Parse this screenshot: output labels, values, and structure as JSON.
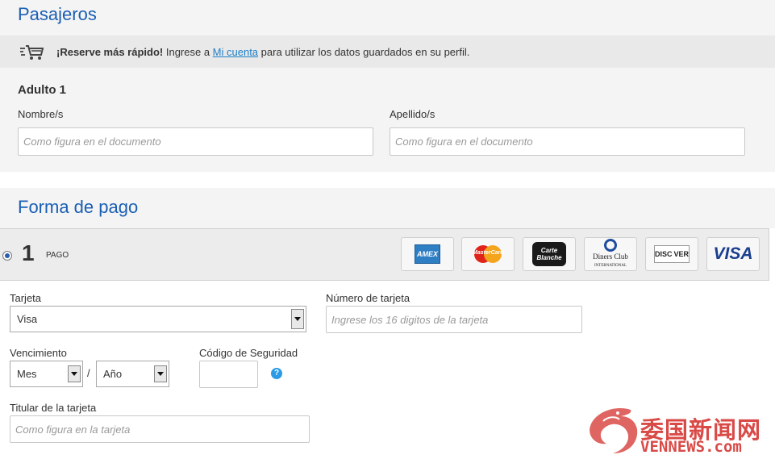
{
  "passengers": {
    "title": "Pasajeros",
    "notice": {
      "bold": "¡Reserve más rápido!",
      "before_link": " Ingrese a ",
      "link": "Mi cuenta",
      "after_link": " para utilizar los datos guardados en su perfil."
    },
    "adult_title": "Adulto 1",
    "first_name_label": "Nombre/s",
    "first_name_placeholder": "Como figura en el documento",
    "last_name_label": "Apellido/s",
    "last_name_placeholder": "Como figura en el documento"
  },
  "payment": {
    "title": "Forma de pago",
    "installments_number": "1",
    "installments_label": "PAGO",
    "cards": [
      {
        "name": "AMEX",
        "icon": "amex-icon"
      },
      {
        "name": "MasterCard",
        "icon": "mastercard-icon"
      },
      {
        "name": "Carte Blanche",
        "icon": "carte-blanche-icon"
      },
      {
        "name": "Diners Club International",
        "icon": "diners-club-icon"
      },
      {
        "name": "DISCOVER",
        "icon": "discover-icon"
      },
      {
        "name": "VISA",
        "icon": "visa-icon"
      }
    ],
    "card_label": "Tarjeta",
    "card_value": "Visa",
    "number_label": "Número de tarjeta",
    "number_placeholder": "Ingrese los 16 digitos de la tarjeta",
    "expiry_label": "Vencimiento",
    "month_value": "Mes",
    "year_value": "Año",
    "separator": "/",
    "cvv_label": "Código de Seguridad",
    "help_symbol": "?",
    "holder_label": "Titular de la tarjeta",
    "holder_placeholder": "Como figura en la tarjeta"
  },
  "watermark": {
    "chinese": "委国新闻网",
    "latin": "VENNEWS.com"
  },
  "colors": {
    "heading": "#1a5fb4",
    "link": "#1e7fc8",
    "watermark": "#d94a47"
  }
}
